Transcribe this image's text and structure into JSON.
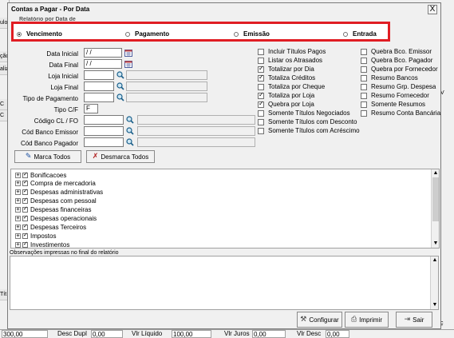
{
  "background": {
    "left_stubs": [
      "ulo",
      "ção",
      "aliz",
      "C",
      "C",
      "Tít"
    ],
    "right_stubs": [
      "V",
      "ç"
    ],
    "status": {
      "total": "300,00",
      "desc_dupl_label": "Desc Dupl",
      "desc_dupl": "0,00",
      "vlr_liquido_label": "Vlr Líquido",
      "vlr_liquido": "100,00",
      "vlr_juros_label": "Vlr Juros",
      "vlr_juros": "0,00",
      "vlr_desc_label": "Vlr Desc",
      "vlr_desc": "0,00"
    }
  },
  "dialog": {
    "title": "Contas a Pagar - Por Data",
    "close_glyph": "X",
    "subtitle": "Relatório por Data de",
    "radios": [
      {
        "label": "Vencimento",
        "selected": true
      },
      {
        "label": "Pagamento",
        "selected": false
      },
      {
        "label": "Emissão",
        "selected": false
      },
      {
        "label": "Entrada",
        "selected": false
      }
    ],
    "fields": {
      "data_inicial": {
        "label": "Data Inicial",
        "value": " / /"
      },
      "data_final": {
        "label": "Data Final",
        "value": " / /"
      },
      "loja_inicial": {
        "label": "Loja Inicial",
        "value": ""
      },
      "loja_final": {
        "label": "Loja Final",
        "value": ""
      },
      "tipo_pagamento": {
        "label": "Tipo de Pagamento",
        "value": ""
      },
      "tipo_cf": {
        "label": "Tipo C/F",
        "value": "F"
      },
      "codigo_cl_fo": {
        "label": "Código CL / FO",
        "value": ""
      },
      "cod_banco_emissor": {
        "label": "Cód Banco Emissor",
        "value": ""
      },
      "cod_banco_pagador": {
        "label": "Cód Banco Pagador",
        "value": ""
      }
    },
    "checks_middle": [
      {
        "label": "Incluir Títulos Pagos",
        "checked": false
      },
      {
        "label": "Listar os Atrasados",
        "checked": false
      },
      {
        "label": "Totalizar por Dia",
        "checked": true
      },
      {
        "label": "Totaliza Créditos",
        "checked": true
      },
      {
        "label": "Totaliza por Cheque",
        "checked": false
      },
      {
        "label": "Totaliza por Loja",
        "checked": true
      },
      {
        "label": "Quebra por Loja",
        "checked": true
      },
      {
        "label": "Somente Títulos Negociados",
        "checked": false
      },
      {
        "label": "Somente Títulos com Desconto",
        "checked": false
      },
      {
        "label": "Somente Títulos com Acréscimo",
        "checked": false
      }
    ],
    "checks_right": [
      {
        "label": "Quebra Bco. Emissor",
        "checked": false
      },
      {
        "label": "Quebra Bco. Pagador",
        "checked": false
      },
      {
        "label": "Quebra por Fornecedor",
        "checked": false
      },
      {
        "label": "Resumo Bancos",
        "checked": false
      },
      {
        "label": "Resumo Grp. Despesa",
        "checked": false
      },
      {
        "label": "Resumo Fornecedor",
        "checked": false
      },
      {
        "label": "Somente Resumos",
        "checked": false
      },
      {
        "label": "Resumo Conta Bancária",
        "checked": false
      }
    ],
    "marca_todos": "Marca Todos",
    "desmarca_todos": "Desmarca Todos",
    "tree": [
      "Bonificacoes",
      "Compra de mercadoria",
      "Despesas administrativas",
      "Despesas com pessoal",
      "Despesas financeiras",
      "Despesas operacionais",
      "Despesas Terceiros",
      "Impostos",
      "Investimentos"
    ],
    "obs_label": "Observações impressas no final do relatório",
    "buttons": {
      "configurar": "Configurar",
      "imprimir": "Imprimir",
      "sair": "Sair"
    },
    "colors": {
      "highlight": "#e01d23",
      "accent_blue": "#4a7fd4"
    }
  }
}
